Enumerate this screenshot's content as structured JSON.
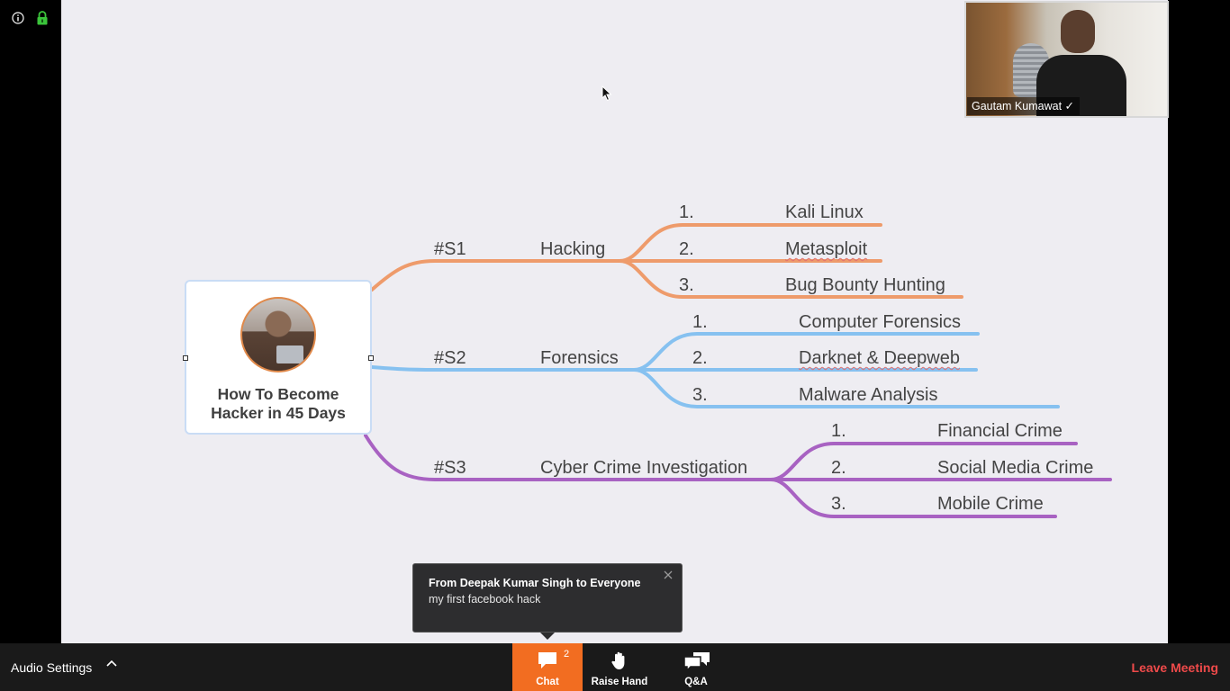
{
  "colors": {
    "branch_s1": "#ee9b6b",
    "branch_s2": "#86c1f0",
    "branch_s3": "#a862c2",
    "chat_button": "#f26d21",
    "leave_text": "#ef4a4a"
  },
  "security": {
    "info_icon": "info-icon",
    "lock_icon": "lock-icon"
  },
  "mindmap": {
    "center_title_line1": "How To Become",
    "center_title_line2": "Hacker in 45 Days",
    "branches": [
      {
        "tag": "#S1",
        "topic": "Hacking",
        "items": [
          {
            "num": "1.",
            "label": "Kali Linux"
          },
          {
            "num": "2.",
            "label": "Metasploit"
          },
          {
            "num": "3.",
            "label": "Bug Bounty Hunting"
          }
        ]
      },
      {
        "tag": "#S2",
        "topic": "Forensics",
        "items": [
          {
            "num": "1.",
            "label": "Computer Forensics"
          },
          {
            "num": "2.",
            "label": "Darknet & Deepweb"
          },
          {
            "num": "3.",
            "label": "Malware Analysis"
          }
        ]
      },
      {
        "tag": "#S3",
        "topic": "Cyber Crime Investigation",
        "items": [
          {
            "num": "1.",
            "label": "Financial Crime"
          },
          {
            "num": "2.",
            "label": "Social Media Crime"
          },
          {
            "num": "3.",
            "label": "Mobile Crime"
          }
        ]
      }
    ]
  },
  "video": {
    "participant_name": "Gautam Kumawat ✓"
  },
  "chat_popup": {
    "from": "From Deepak Kumar Singh to Everyone",
    "message": "my first facebook hack"
  },
  "toolbar": {
    "audio_settings": "Audio Settings",
    "chat_label": "Chat",
    "chat_badge": "2",
    "raise_hand_label": "Raise Hand",
    "qa_label": "Q&A",
    "leave_label": "Leave Meeting"
  }
}
